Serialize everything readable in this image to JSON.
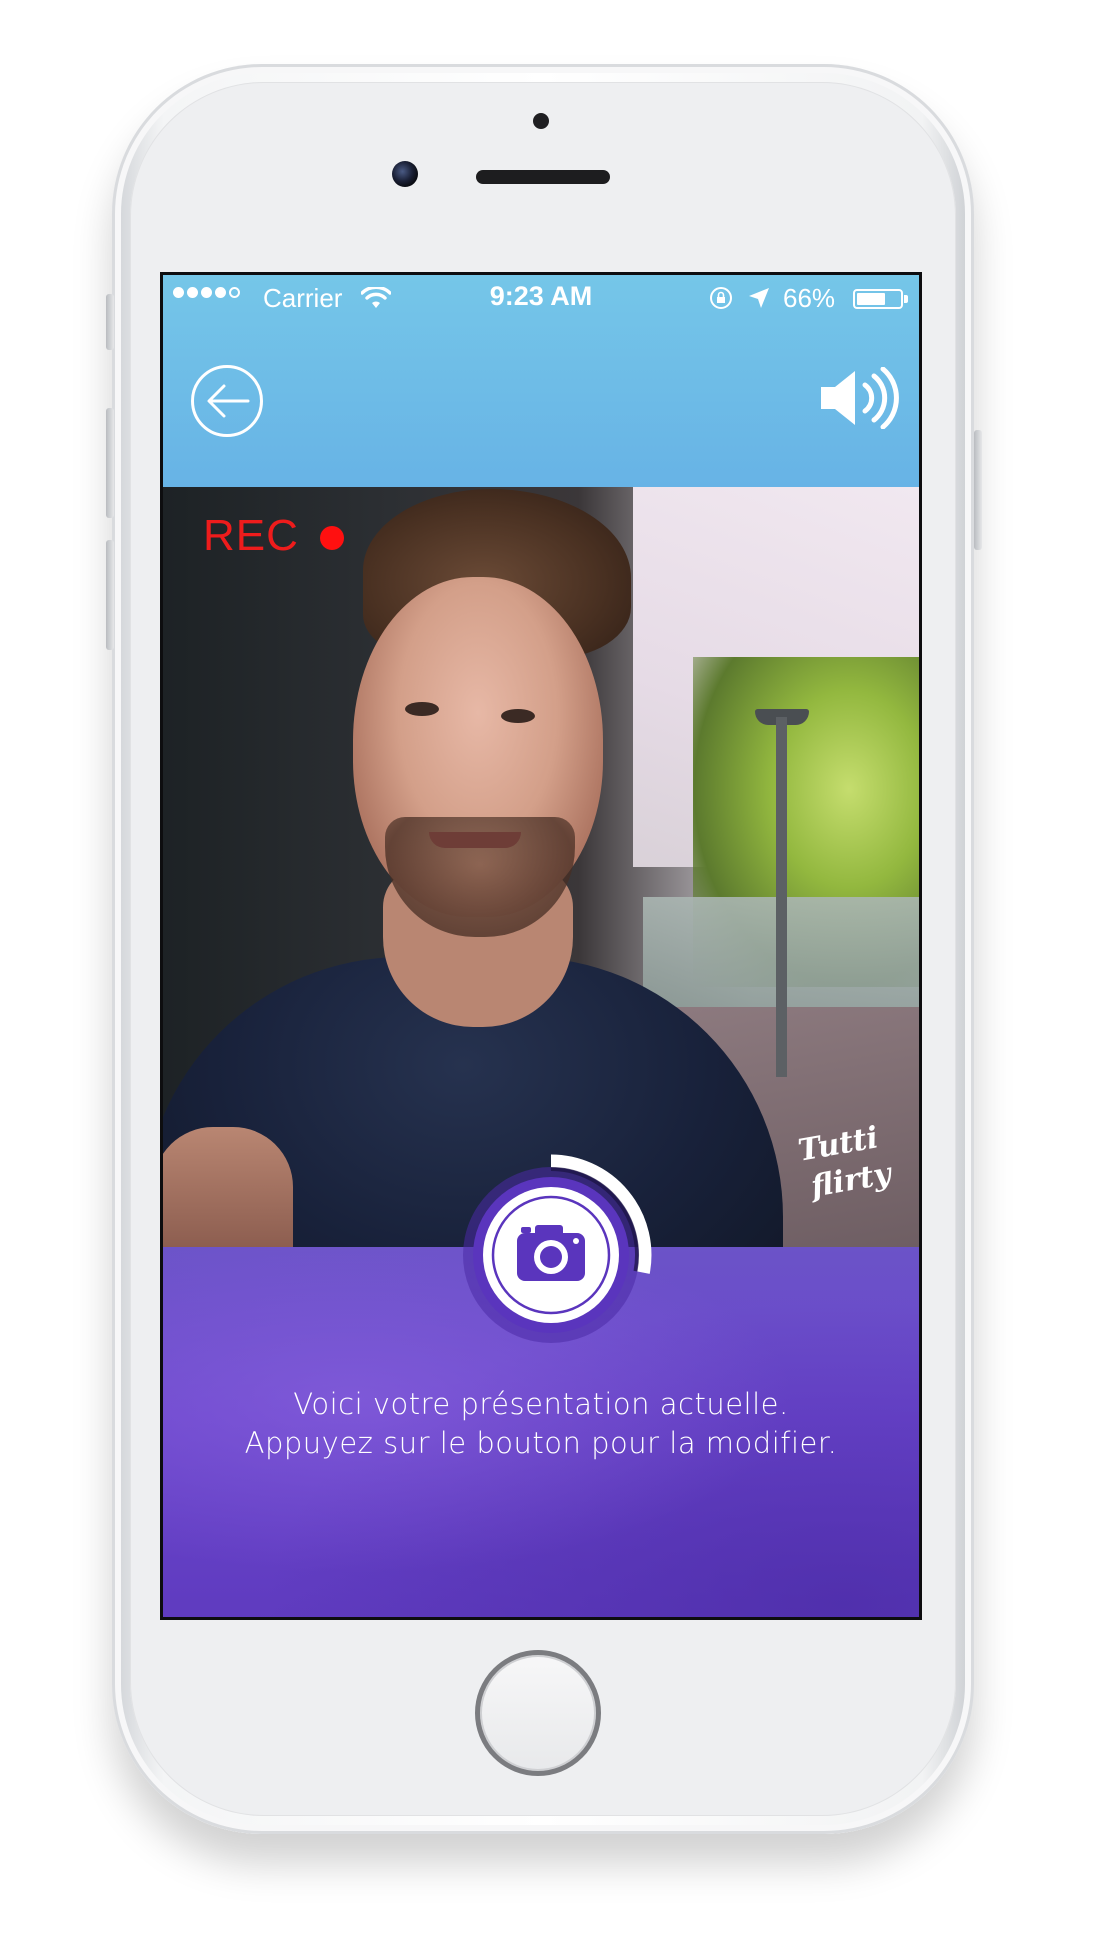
{
  "status_bar": {
    "carrier": "Carrier",
    "time": "9:23 AM",
    "battery_percent": "66%",
    "battery_level": 0.66,
    "signal_bars_filled": 4,
    "signal_bars_total": 5
  },
  "header": {
    "back_icon": "back-arrow-circle-icon",
    "sound_icon": "speaker-volume-icon"
  },
  "video": {
    "rec_label": "REC",
    "brand_line1": "Tutti",
    "brand_line2": "flirty"
  },
  "record_button": {
    "icon": "camera-icon",
    "progress": 0.28
  },
  "message": {
    "line1": "Voici votre présentation actuelle.",
    "line2": "Appuyez sur le bouton pour la modifier."
  },
  "colors": {
    "header_blue": "#6cbbe7",
    "panel_purple": "#6a45cc",
    "rec_red": "#ee1c1c"
  }
}
